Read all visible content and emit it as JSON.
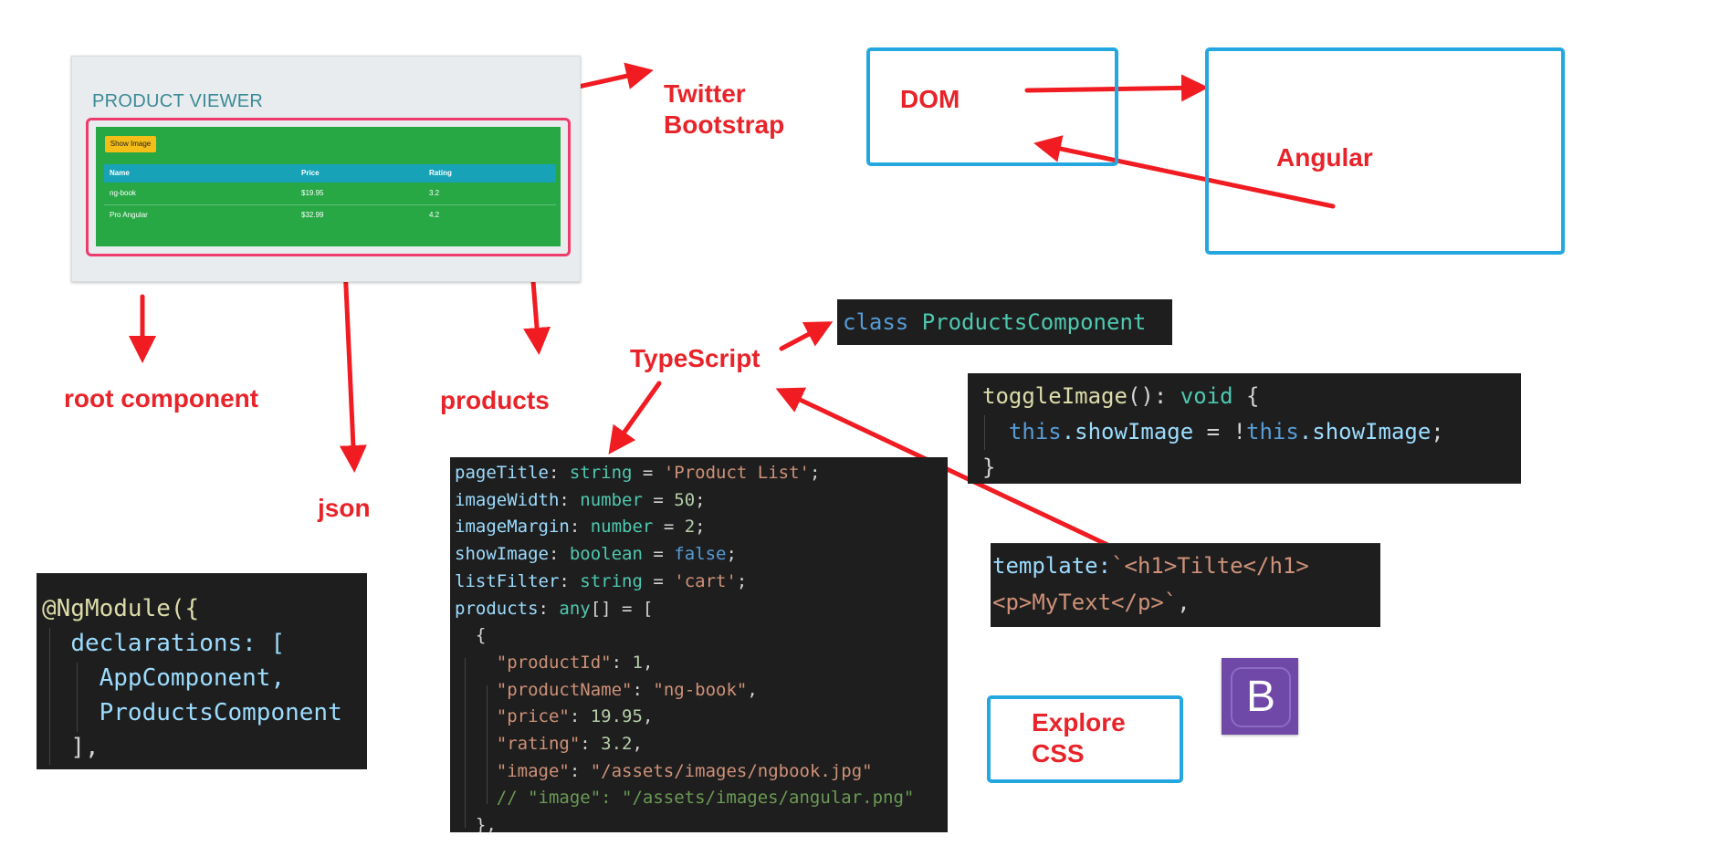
{
  "product_viewer": {
    "title": "PRODUCT VIEWER",
    "show_image_button": "Show Image",
    "columns": [
      "Name",
      "Price",
      "Rating"
    ],
    "rows": [
      [
        "ng-book",
        "$19.95",
        "3.2"
      ],
      [
        "Pro Angular",
        "$32.99",
        "4.2"
      ]
    ]
  },
  "labels": {
    "twitter": "Twitter",
    "bootstrap": "Bootstrap",
    "dom": "DOM",
    "angular": "Angular",
    "typescript": "TypeScript",
    "root_component": "root component",
    "products": "products",
    "json": "json",
    "explore": "Explore",
    "css": "CSS"
  },
  "code_class": {
    "keyword": "class",
    "name": "ProductsComponent"
  },
  "code_toggle": {
    "l1_fn": "toggleImage",
    "l1_rest": "(): ",
    "l1_type": "void",
    "l1_brace": " {",
    "l2_this1": "this",
    "l2_prop1": ".showImage",
    "l2_mid": " = !",
    "l2_this2": "this",
    "l2_prop2": ".showImage",
    "l2_end": ";",
    "l3": "}"
  },
  "code_template": {
    "key": "template:",
    "l1": "`<h1>Tilte</h1>",
    "l2": "<p>MyText</p>`",
    "l2_end": ","
  },
  "code_module": {
    "l1": "@NgModule({",
    "l2": "declarations: [",
    "l3": "AppComponent,",
    "l4": "ProductsComponent",
    "l5": "],"
  },
  "code_props": {
    "l1_name": "pageTitle",
    "l1_type": "string",
    "l1_val": "'Product List'",
    "l2_name": "imageWidth",
    "l2_type": "number",
    "l2_val": "50",
    "l3_name": "imageMargin",
    "l3_type": "number",
    "l3_val": "2",
    "l4_name": "showImage",
    "l4_type": "boolean",
    "l4_val": "false",
    "l5_name": "listFilter",
    "l5_type": "string",
    "l5_val": "'cart'",
    "l6_name": "products",
    "l6_type": "any",
    "l6_rest": "[] = [",
    "l7": "{",
    "l8_key": "\"productId\"",
    "l8_val": "1",
    "l9_key": "\"productName\"",
    "l9_val": "\"ng-book\"",
    "l10_key": "\"price\"",
    "l10_val": "19.95",
    "l11_key": "\"rating\"",
    "l11_val": "3.2",
    "l12_key": "\"image\"",
    "l12_val": "\"/assets/images/ngbook.jpg\"",
    "l13_comment": "// \"image\": \"/assets/images/angular.png\"",
    "l14": "},"
  },
  "bootstrap_logo": {
    "letter": "B",
    "color": "#6f48a8"
  },
  "colors": {
    "annotation_red": "#e8242a",
    "box_blue": "#24a7e0",
    "highlight_pink": "#ee3b6b"
  }
}
